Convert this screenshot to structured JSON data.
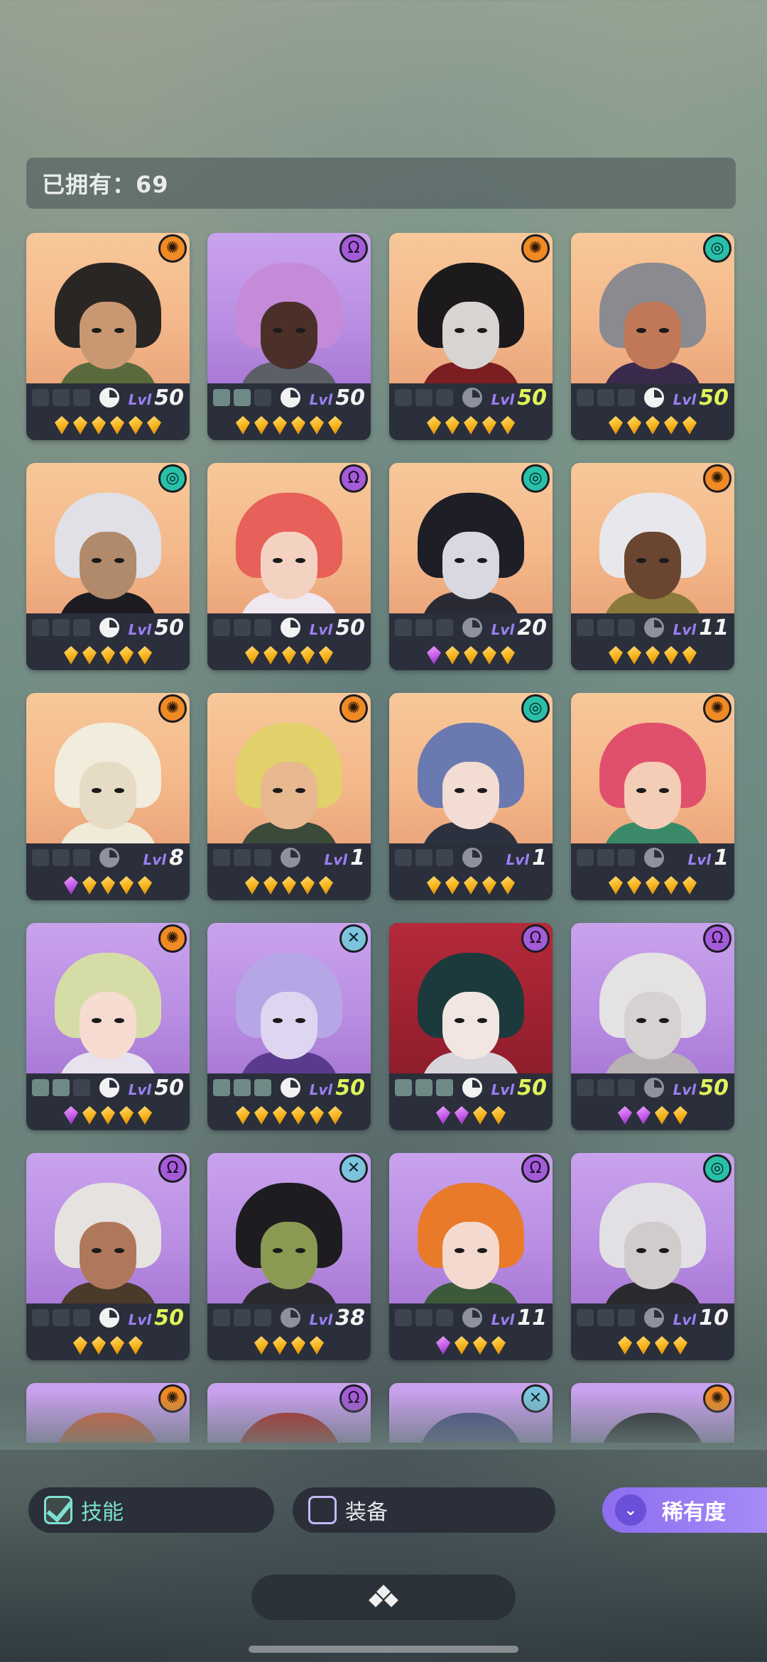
{
  "header": {
    "owned_label": "已拥有：69"
  },
  "cards": [
    {
      "bg": "orange",
      "faction": "sun",
      "faction_glyph": "✺",
      "hair": "#2a2624",
      "face": "#c99872",
      "clothes": "#5a6a3c",
      "slots_on": 0,
      "skill": "white",
      "level": "50",
      "max": false,
      "stars": [
        "gold",
        "gold",
        "gold",
        "gold",
        "gold",
        "gold"
      ]
    },
    {
      "bg": "purple",
      "faction": "omega",
      "faction_glyph": "Ω",
      "hair": "#c58ad8",
      "face": "#4a3028",
      "clothes": "#5c5f66",
      "slots_on": 2,
      "skill": "white",
      "level": "50",
      "max": false,
      "stars": [
        "gold",
        "gold",
        "gold",
        "gold",
        "gold",
        "gold"
      ]
    },
    {
      "bg": "orange",
      "faction": "sun",
      "faction_glyph": "✺",
      "hair": "#1c1a1c",
      "face": "#d8d4d2",
      "clothes": "#7a1e22",
      "slots_on": 0,
      "skill": "grey",
      "level": "50",
      "max": true,
      "stars": [
        "gold",
        "gold",
        "gold",
        "gold",
        "gold"
      ]
    },
    {
      "bg": "orange",
      "faction": "spiral",
      "faction_glyph": "◎",
      "hair": "#8a8a90",
      "face": "#c07858",
      "clothes": "#3a2a4c",
      "slots_on": 0,
      "skill": "white",
      "level": "50",
      "max": true,
      "stars": [
        "gold",
        "gold",
        "gold",
        "gold",
        "gold"
      ]
    },
    {
      "bg": "orange",
      "faction": "spiral",
      "faction_glyph": "◎",
      "hair": "#e0e0e6",
      "face": "#b08a6a",
      "clothes": "#1c1c22",
      "slots_on": 0,
      "skill": "white",
      "level": "50",
      "max": false,
      "stars": [
        "gold",
        "gold",
        "gold",
        "gold",
        "gold"
      ]
    },
    {
      "bg": "orange",
      "faction": "omega",
      "faction_glyph": "Ω",
      "hair": "#e8605a",
      "face": "#f4d2c2",
      "clothes": "#f0e8f0",
      "slots_on": 0,
      "skill": "white",
      "level": "50",
      "max": false,
      "stars": [
        "gold",
        "gold",
        "gold",
        "gold",
        "gold"
      ]
    },
    {
      "bg": "orange",
      "faction": "spiral",
      "faction_glyph": "◎",
      "hair": "#1e1e26",
      "face": "#d8d8e0",
      "clothes": "#2a2a34",
      "slots_on": 0,
      "skill": "grey",
      "level": "20",
      "max": false,
      "stars": [
        "purple",
        "gold",
        "gold",
        "gold",
        "gold"
      ]
    },
    {
      "bg": "orange",
      "faction": "sun",
      "faction_glyph": "✺",
      "hair": "#e8e8ec",
      "face": "#6a4630",
      "clothes": "#8a7a3c",
      "slots_on": 0,
      "skill": "grey",
      "level": "11",
      "max": false,
      "stars": [
        "gold",
        "gold",
        "gold",
        "gold",
        "gold"
      ]
    },
    {
      "bg": "orange",
      "faction": "sun",
      "faction_glyph": "✺",
      "hair": "#f2ecdc",
      "face": "#e6dcc6",
      "clothes": "#f0ead8",
      "slots_on": 0,
      "skill": "grey",
      "level": "8",
      "max": false,
      "stars": [
        "purple",
        "gold",
        "gold",
        "gold",
        "gold"
      ]
    },
    {
      "bg": "orange",
      "faction": "sun",
      "faction_glyph": "✺",
      "hair": "#e2d06a",
      "face": "#e8b890",
      "clothes": "#3c4a3a",
      "slots_on": 0,
      "skill": "grey",
      "level": "1",
      "max": false,
      "stars": [
        "gold",
        "gold",
        "gold",
        "gold",
        "gold"
      ]
    },
    {
      "bg": "orange",
      "faction": "spiral",
      "faction_glyph": "◎",
      "hair": "#6a7ab0",
      "face": "#f2dcd4",
      "clothes": "#2c3140",
      "slots_on": 0,
      "skill": "grey",
      "level": "1",
      "max": false,
      "stars": [
        "gold",
        "gold",
        "gold",
        "gold",
        "gold"
      ]
    },
    {
      "bg": "orange",
      "faction": "sun",
      "faction_glyph": "✺",
      "hair": "#e0506c",
      "face": "#f4cdb6",
      "clothes": "#3a8a6a",
      "slots_on": 0,
      "skill": "grey",
      "level": "1",
      "max": false,
      "stars": [
        "gold",
        "gold",
        "gold",
        "gold",
        "gold"
      ]
    },
    {
      "bg": "purple",
      "faction": "sun",
      "faction_glyph": "✺",
      "hair": "#d6dca6",
      "face": "#f6dcd0",
      "clothes": "#e8e2ee",
      "slots_on": 2,
      "skill": "white",
      "level": "50",
      "max": false,
      "stars": [
        "purple",
        "gold",
        "gold",
        "gold",
        "gold"
      ]
    },
    {
      "bg": "purple",
      "faction": "cross",
      "faction_glyph": "✕",
      "hair": "#b6a6e6",
      "face": "#ded6f0",
      "clothes": "#5a3a8c",
      "slots_on": 3,
      "skill": "white",
      "level": "50",
      "max": true,
      "stars": [
        "gold",
        "gold",
        "gold",
        "gold",
        "gold",
        "gold"
      ]
    },
    {
      "bg": "red",
      "faction": "omega",
      "faction_glyph": "Ω",
      "hair": "#1c3a3c",
      "face": "#f2e6e2",
      "clothes": "#d8d4dc",
      "slots_on": 3,
      "skill": "white",
      "level": "50",
      "max": true,
      "stars": [
        "purple",
        "purple",
        "gold",
        "gold"
      ]
    },
    {
      "bg": "purple",
      "faction": "omega",
      "faction_glyph": "Ω",
      "hair": "#e4e2e2",
      "face": "#d6d2d2",
      "clothes": "#b8b2b4",
      "slots_on": 0,
      "skill": "grey",
      "level": "50",
      "max": true,
      "stars": [
        "purple",
        "purple",
        "gold",
        "gold"
      ]
    },
    {
      "bg": "purple",
      "faction": "omega",
      "faction_glyph": "Ω",
      "hair": "#e6e2e0",
      "face": "#b0785a",
      "clothes": "#4a3a2a",
      "slots_on": 0,
      "skill": "white",
      "level": "50",
      "max": true,
      "stars": [
        "gold",
        "gold",
        "gold",
        "gold"
      ]
    },
    {
      "bg": "purple",
      "faction": "cross",
      "faction_glyph": "✕",
      "hair": "#1e1c20",
      "face": "#8a9a52",
      "clothes": "#2a2a2e",
      "slots_on": 0,
      "skill": "grey",
      "level": "38",
      "max": false,
      "stars": [
        "gold",
        "gold",
        "gold",
        "gold"
      ]
    },
    {
      "bg": "purple",
      "faction": "omega",
      "faction_glyph": "Ω",
      "hair": "#e87a2a",
      "face": "#f4dace",
      "clothes": "#3c5a3a",
      "slots_on": 0,
      "skill": "grey",
      "level": "11",
      "max": false,
      "stars": [
        "purple",
        "gold",
        "gold",
        "gold"
      ]
    },
    {
      "bg": "purple",
      "faction": "spiral",
      "faction_glyph": "◎",
      "hair": "#e2e0e4",
      "face": "#d0cccc",
      "clothes": "#2a2a2e",
      "slots_on": 0,
      "skill": "grey",
      "level": "10",
      "max": false,
      "stars": [
        "gold",
        "gold",
        "gold",
        "gold"
      ]
    },
    {
      "bg": "purple",
      "faction": "sun",
      "faction_glyph": "✺",
      "hair": "#d8603c",
      "face": "#e8b48a",
      "clothes": "#4a3a2a",
      "slots_on": 0,
      "skill": "grey",
      "level": "",
      "max": false,
      "stars": []
    },
    {
      "bg": "purple",
      "faction": "omega",
      "faction_glyph": "Ω",
      "hair": "#b22a28",
      "face": "#3a2222",
      "clothes": "#2a1a1a",
      "slots_on": 0,
      "skill": "grey",
      "level": "",
      "max": false,
      "stars": []
    },
    {
      "bg": "purple",
      "faction": "cross",
      "faction_glyph": "✕",
      "hair": "#4a4e8a",
      "face": "#6a6ea4",
      "clothes": "#3a3e70",
      "slots_on": 0,
      "skill": "grey",
      "level": "",
      "max": false,
      "stars": []
    },
    {
      "bg": "purple",
      "faction": "sun",
      "faction_glyph": "✺",
      "hair": "#2a2a30",
      "face": "#5a5a66",
      "clothes": "#3a3a40",
      "slots_on": 0,
      "skill": "grey",
      "level": "",
      "max": false,
      "stars": []
    }
  ],
  "level_prefix": "Lvl",
  "filters": {
    "skill_label": "技能",
    "skill_checked": true,
    "equip_label": "装备",
    "equip_checked": false,
    "sort_label": "稀有度"
  },
  "colors": {
    "accent": "#9b7ff2",
    "max_level": "#dff55a",
    "gold_gem": "#f7b21a",
    "purple_gem": "#c35ae8"
  }
}
